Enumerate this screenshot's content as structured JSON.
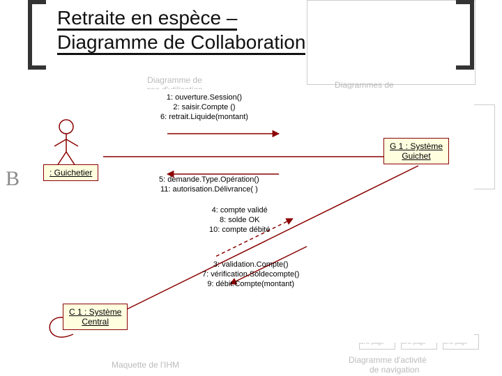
{
  "title": {
    "line1": "Retraite en espèce –",
    "line2": "Diagramme de Collaboration"
  },
  "background": {
    "left_label": "B",
    "top_right_label": "Diagrammes de",
    "top_center_lines": "Diagramme de\ncas d'utilisation",
    "bottom_left": "Maquette de l'IHM",
    "bottom_right_l1": "Diagramme d'activité",
    "bottom_right_l2": "de navigation",
    "mini_label": "Une page"
  },
  "actors": {
    "guichetier": ": Guichetier",
    "guichet": "G 1 : Système\nGuichet",
    "central": "C 1 : Système\nCentral"
  },
  "messages": {
    "top_forward": "1: ouverture.Session()\n2: saisir.Compte ()\n6: retrait.Liquide(montant)",
    "top_back": "5: demande.Type.Opération()\n11: autorisation.Délivrance( )",
    "mid_return": "4: compte validé\n8: solde OK\n10: compte débité",
    "bottom_call": "3: validation.Compte()\n7: vérification.Soldecompte()\n9: débit.Compte(montant)"
  },
  "chart_data": {
    "type": "uml-collaboration",
    "title": "Retraite en espèce – Diagramme de Collaboration",
    "participants": [
      {
        "id": "guichetier",
        "label": ": Guichetier",
        "kind": "actor"
      },
      {
        "id": "g1",
        "label": "G 1 : Système Guichet",
        "kind": "object"
      },
      {
        "id": "c1",
        "label": "C 1 : Système Central",
        "kind": "object"
      }
    ],
    "messages": [
      {
        "seq": 1,
        "from": "guichetier",
        "to": "g1",
        "label": "ouverture.Session()"
      },
      {
        "seq": 2,
        "from": "guichetier",
        "to": "g1",
        "label": "saisir.Compte ()"
      },
      {
        "seq": 3,
        "from": "g1",
        "to": "c1",
        "label": "validation.Compte()"
      },
      {
        "seq": 4,
        "from": "c1",
        "to": "g1",
        "label": "compte validé"
      },
      {
        "seq": 5,
        "from": "g1",
        "to": "guichetier",
        "label": "demande.Type.Opération()"
      },
      {
        "seq": 6,
        "from": "guichetier",
        "to": "g1",
        "label": "retrait.Liquide(montant)"
      },
      {
        "seq": 7,
        "from": "g1",
        "to": "c1",
        "label": "vérification.Soldecompte()"
      },
      {
        "seq": 8,
        "from": "c1",
        "to": "g1",
        "label": "solde OK"
      },
      {
        "seq": 9,
        "from": "g1",
        "to": "c1",
        "label": "débit.Compte(montant)"
      },
      {
        "seq": 10,
        "from": "c1",
        "to": "g1",
        "label": "compte débité"
      },
      {
        "seq": 11,
        "from": "g1",
        "to": "guichetier",
        "label": "autorisation.Délivrance( )"
      }
    ],
    "self_link": {
      "on": "c1"
    }
  }
}
